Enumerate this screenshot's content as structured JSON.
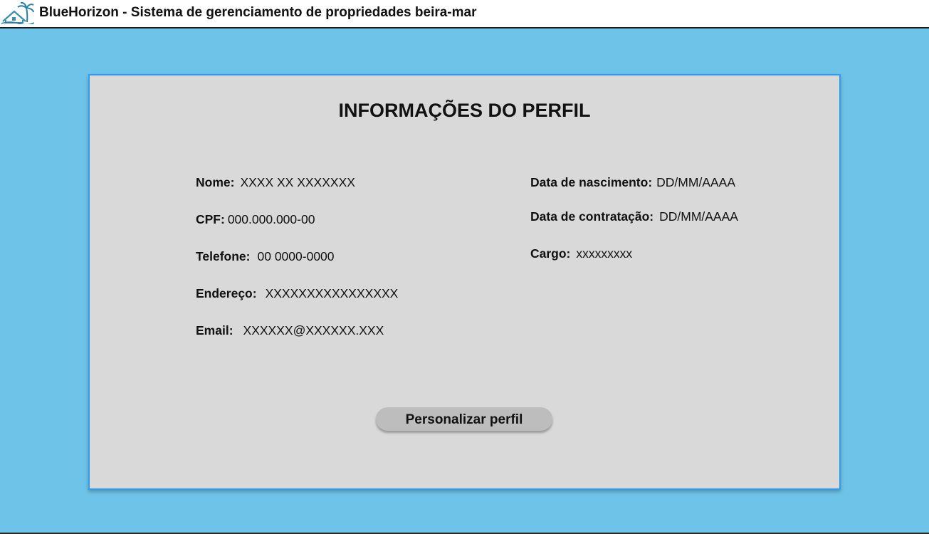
{
  "header": {
    "title": "BlueHorizon - Sistema de gerenciamento de propriedades beira-mar",
    "logo_icon": "beach-house-palm-icon"
  },
  "profile": {
    "title": "INFORMAÇÕES DO PERFIL",
    "left_fields": [
      {
        "label": "Nome:",
        "value": "XXXX XX XXXXXXX"
      },
      {
        "label": "CPF:",
        "value": "000.000.000-00"
      },
      {
        "label": "Telefone:",
        "value": "00 0000-0000"
      },
      {
        "label": "Endereço:",
        "value": "XXXXXXXXXXXXXXXX"
      },
      {
        "label": "Email:",
        "value": "XXXXXX@XXXXXX.XXX"
      }
    ],
    "right_fields": [
      {
        "label": "Data de nascimento:",
        "value": "DD/MM/AAAA"
      },
      {
        "label": "Data de contratação:",
        "value": "DD/MM/AAAA"
      },
      {
        "label": "Cargo:",
        "value": "xxxxxxxxx"
      }
    ],
    "button_label": "Personalizar perfil"
  },
  "colors": {
    "background": "#6ec4e8",
    "card": "#d9d9d9",
    "card_border": "#2f9cf4",
    "button": "#bdbdbd"
  }
}
